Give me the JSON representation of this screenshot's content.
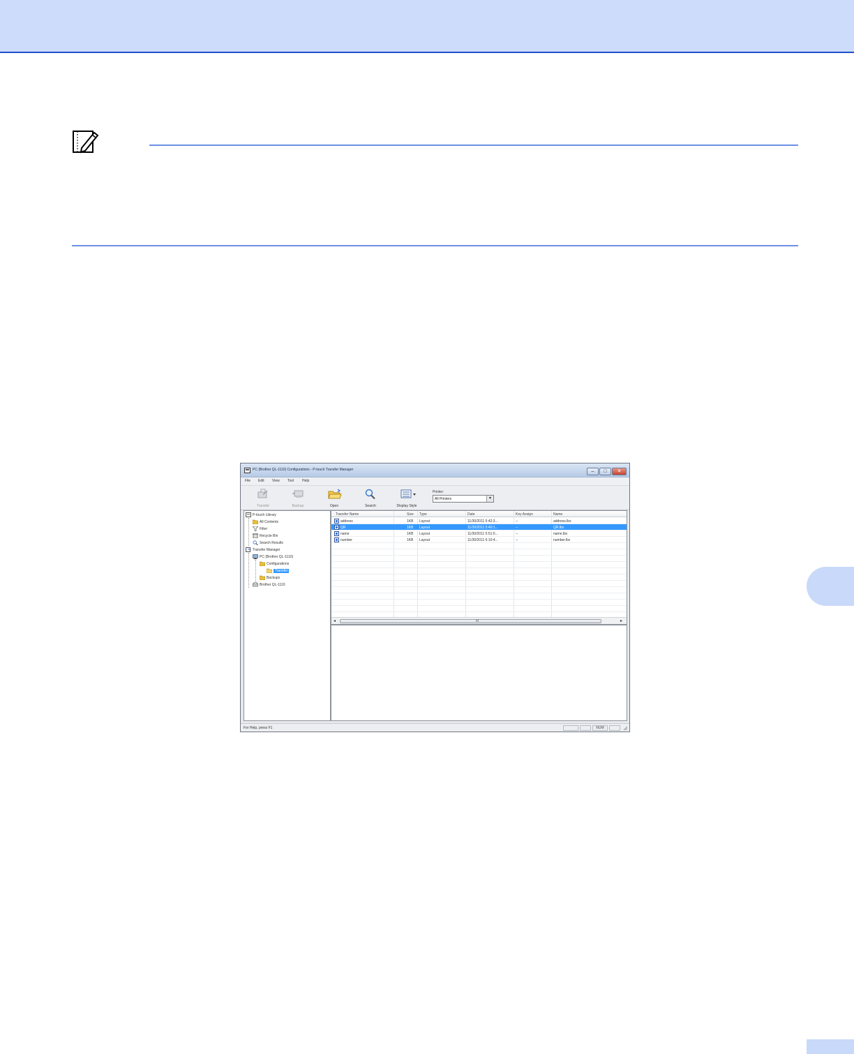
{
  "window": {
    "title": "PC (Brother QL-1110) Configurations - P-touch Transfer Manager",
    "controls": {
      "minimize": "–",
      "maximize": "□",
      "close": "✕"
    }
  },
  "menu": [
    "File",
    "Edit",
    "View",
    "Tool",
    "Help"
  ],
  "toolbar": {
    "buttons": [
      {
        "label": "Transfer",
        "icon": "transfer-icon",
        "enabled": false
      },
      {
        "label": "Backup",
        "icon": "backup-icon",
        "enabled": false
      },
      {
        "label": "Open",
        "icon": "open-folder-icon",
        "enabled": true
      },
      {
        "label": "Search",
        "icon": "search-icon",
        "enabled": true
      },
      {
        "label": "Display Style",
        "icon": "display-style-icon",
        "enabled": true
      }
    ],
    "printer_label": "Printer:",
    "printer_value": "All Printers"
  },
  "tree": [
    {
      "label": "P-touch Library",
      "icon": "library-icon"
    },
    {
      "label": "All Contents",
      "icon": "folder-icon"
    },
    {
      "label": "Filter",
      "icon": "filter-icon"
    },
    {
      "label": "Recycle Bin",
      "icon": "recycle-bin-icon"
    },
    {
      "label": "Search Results",
      "icon": "search-icon"
    },
    {
      "label": "Transfer Manager",
      "icon": "transfer-manager-icon"
    },
    {
      "label": "PC (Brother QL-1110)",
      "icon": "pc-icon"
    },
    {
      "label": "Configurations",
      "icon": "folder-icon"
    },
    {
      "label": "Transfer",
      "icon": "folder-icon",
      "selected": true
    },
    {
      "label": "Backups",
      "icon": "folder-icon"
    },
    {
      "label": "Brother QL-1110",
      "icon": "printer-icon"
    }
  ],
  "list": {
    "columns": [
      "Transfer Name",
      "Size",
      "Type",
      "Date",
      "Key Assign",
      "Name"
    ],
    "rows": [
      {
        "transfer_name": "address",
        "size": "1KB",
        "type": "Layout",
        "date": "11/30/2011 5:42:3...",
        "key_assign": "--",
        "name": "address.lbx",
        "selected": false
      },
      {
        "transfer_name": "QR",
        "size": "1KB",
        "type": "Layout",
        "date": "11/30/2011 5:40:1...",
        "key_assign": "--",
        "name": "QR.lbx",
        "selected": true
      },
      {
        "transfer_name": "name",
        "size": "1KB",
        "type": "Layout",
        "date": "11/30/2011 5:51:0...",
        "key_assign": "--",
        "name": "name.lbx",
        "selected": false
      },
      {
        "transfer_name": "number",
        "size": "1KB",
        "type": "Layout",
        "date": "11/30/2011 6:10:4...",
        "key_assign": "--",
        "name": "number.lbx",
        "selected": false
      }
    ],
    "scroll_grip": "III"
  },
  "status": {
    "text": "For Help, press F1",
    "indicator": "NUM"
  }
}
